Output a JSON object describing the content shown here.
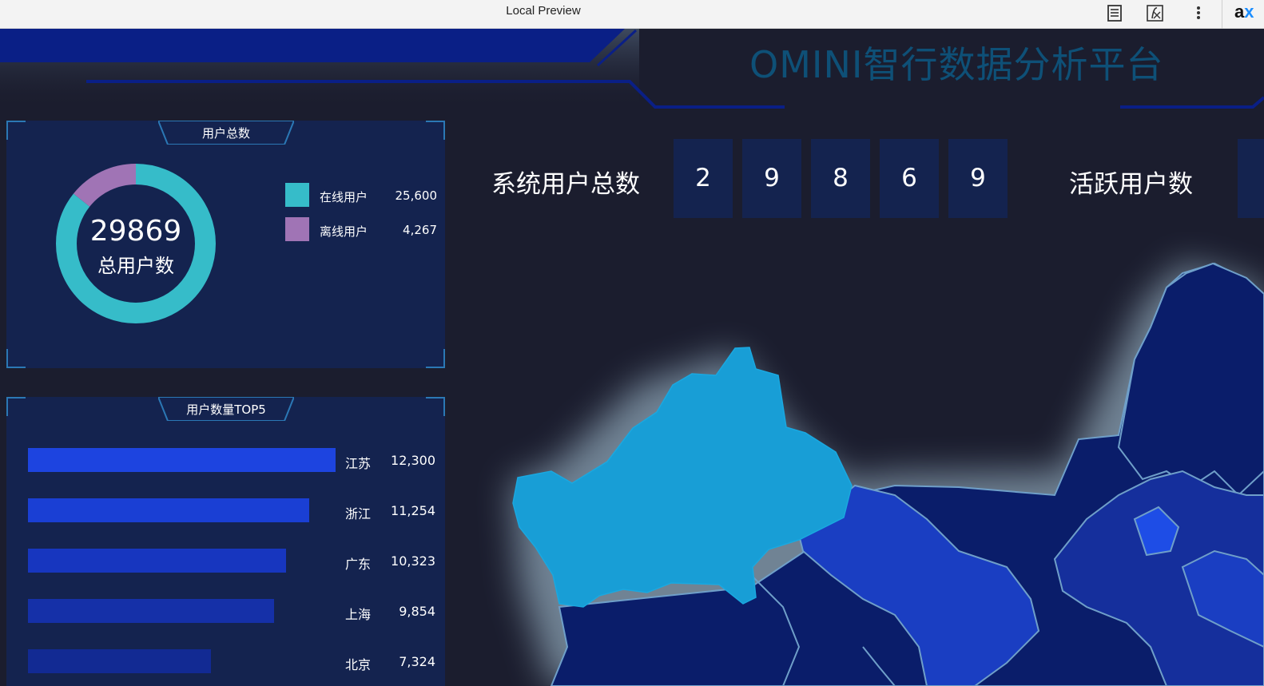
{
  "browser": {
    "title": "Local Preview",
    "extension_label_a": "a",
    "extension_label_x": "x"
  },
  "header": {
    "title": "OMINI智行数据分析平台"
  },
  "user_total_panel": {
    "tab_label": "用户总数",
    "total": "29869",
    "total_caption": "总用户数",
    "legend": [
      {
        "label": "在线用户",
        "value": "25,600",
        "color": "#36bcc9",
        "raw": 25600
      },
      {
        "label": "离线用户",
        "value": "4,267",
        "color": "#a074b5",
        "raw": 4267
      }
    ]
  },
  "top5_panel": {
    "tab_label": "用户数量TOP5",
    "rows": [
      {
        "name": "江苏",
        "value": "12,300",
        "raw": 12300,
        "color": "#1d44e0"
      },
      {
        "name": "浙江",
        "value": "11,254",
        "raw": 11254,
        "color": "#1a3fd4"
      },
      {
        "name": "广东",
        "value": "10,323",
        "raw": 10323,
        "color": "#1736bf"
      },
      {
        "name": "上海",
        "value": "9,854",
        "raw": 9854,
        "color": "#1530a8"
      },
      {
        "name": "北京",
        "value": "7,324",
        "raw": 7324,
        "color": "#122a93"
      }
    ]
  },
  "stats": {
    "system_users_label": "系统用户总数",
    "system_users_digits": [
      "2",
      "9",
      "8",
      "6",
      "9"
    ],
    "active_users_label": "活跃用户数"
  },
  "colors": {
    "background": "#1b1d2e",
    "panel": "#14234f",
    "title": "#0e5077",
    "map_highlight": "#189ed6",
    "map_province": "#0a1d6a",
    "map_mid": "#1a3ec2"
  }
}
